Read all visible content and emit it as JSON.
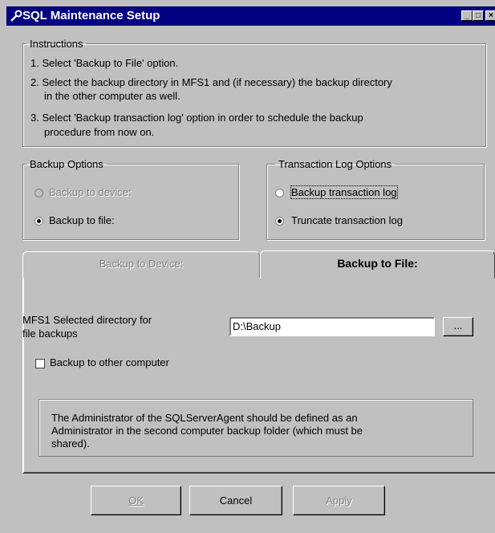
{
  "window": {
    "title": "SQL Maintenance Setup",
    "min_label": "_",
    "max_label": "□",
    "close_label": "×"
  },
  "instructions": {
    "legend": "Instructions",
    "line1": "1. Select 'Backup to File' option.",
    "line2a": "2. Select the backup directory in MFS1 and (if necessary) the backup directory",
    "line2b": "in the other computer as well.",
    "line3a": "3. Select 'Backup transaction log' option in order to schedule the backup",
    "line3b": "procedure from now on."
  },
  "backup_options": {
    "legend": "Backup Options",
    "device_label": "Backup to device:",
    "file_label": "Backup to file:",
    "selected": "file"
  },
  "transaction_options": {
    "legend": "Transaction Log Options",
    "backup_label": "Backup transaction log",
    "truncate_label": "Truncate transaction log",
    "selected": "truncate"
  },
  "tabs": {
    "device": "Backup to Device:",
    "file": "Backup to File:",
    "active": "file"
  },
  "file_tab": {
    "dir_label_1": "MFS1 Selected directory for",
    "dir_label_2": "file backups",
    "dir_value": "D:\\Backup",
    "browse_label": "...",
    "other_computer_label": "Backup to other computer",
    "other_computer_checked": false,
    "note_1": "The Administrator of the SQLServerAgent should be defined as an",
    "note_2": "Administrator in the second computer backup folder (which must be",
    "note_3": "shared)."
  },
  "buttons": {
    "ok": "OK",
    "cancel": "Cancel",
    "apply": "Apply"
  }
}
